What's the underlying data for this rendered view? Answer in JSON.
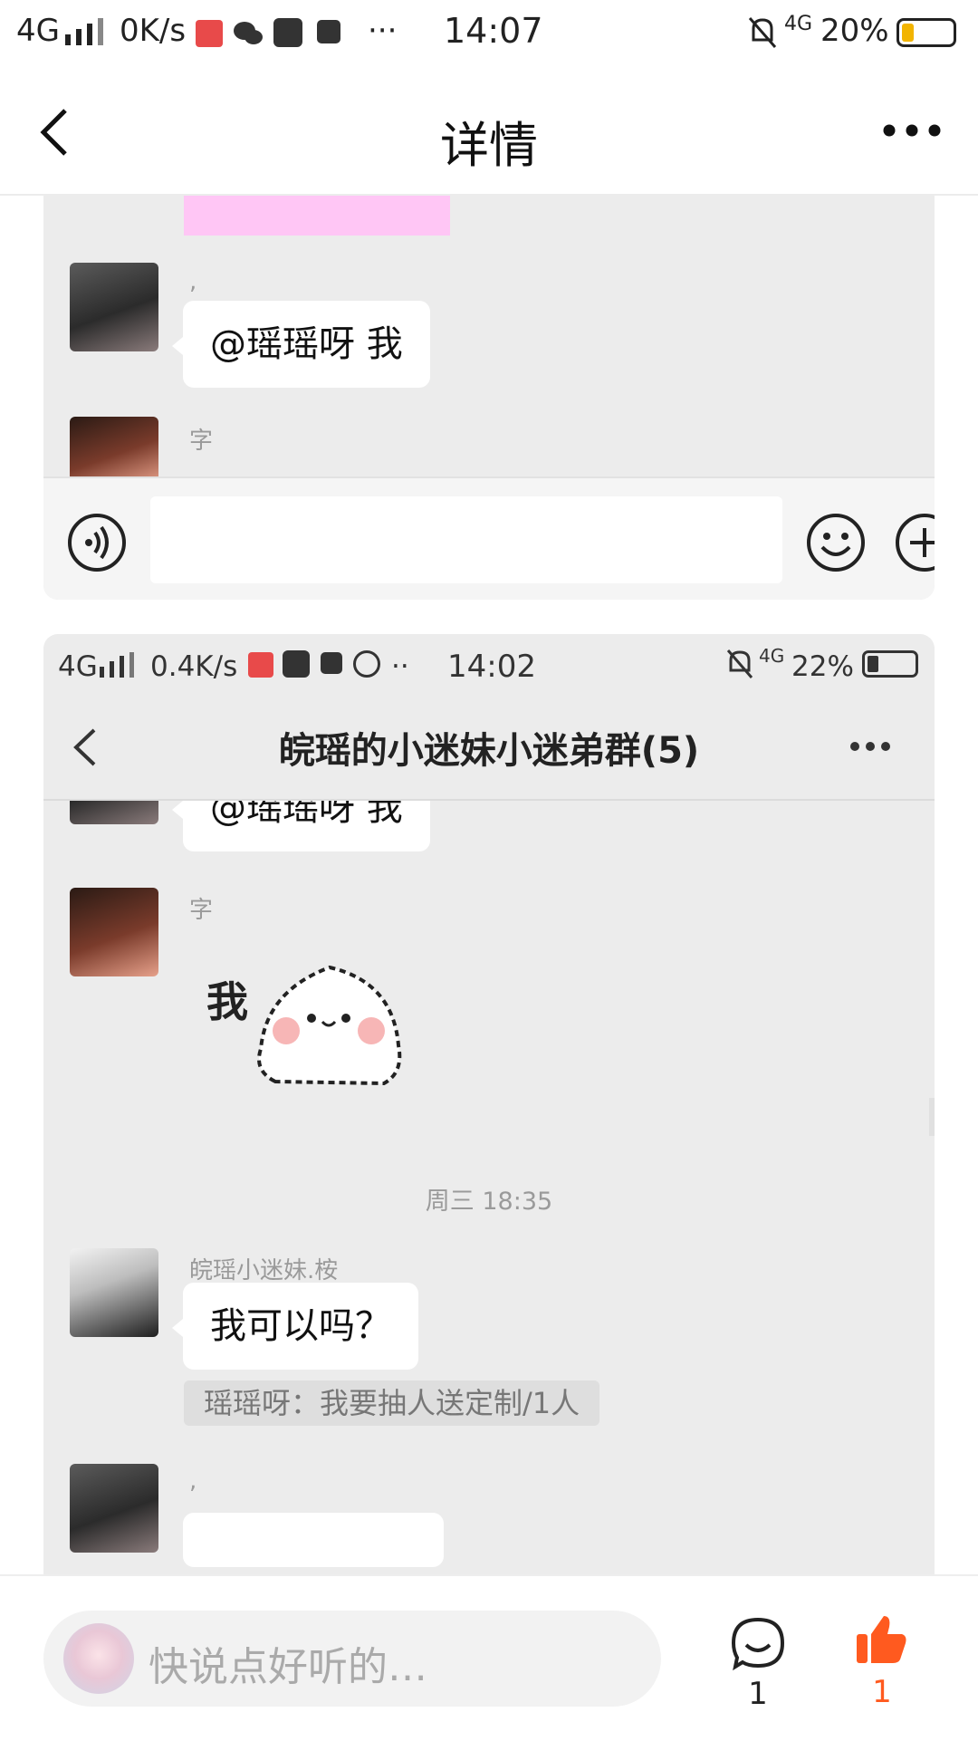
{
  "status_bar": {
    "signal": "4G",
    "speed": "0K/s",
    "dots": "···",
    "time": "14:07",
    "network": "4G",
    "battery": "20%"
  },
  "nav": {
    "title": "详情"
  },
  "top_shot": {
    "messages": [
      {
        "sender": ",",
        "text": "@瑶瑶呀  我"
      },
      {
        "sender": "字"
      }
    ]
  },
  "bottom_shot": {
    "status_bar": {
      "signal": "4G",
      "speed": "0.4K/s",
      "dots": "··",
      "time": "14:02",
      "network": "4G",
      "battery": "22%"
    },
    "title": "皖瑶的小迷妹小迷弟群(5)",
    "partial_bubble": "@瑶瑶呀  我",
    "sender_1": "字",
    "sticker_text": "我",
    "timestamp": "周三 18:35",
    "sender_2": "皖瑶小迷妹.桉",
    "message_2": "我可以吗？",
    "quote": "瑶瑶呀：我要抽人送定制/1人",
    "sender_3": ","
  },
  "footer": {
    "comment_placeholder": "快说点好听的…",
    "comment_count": "1",
    "like_count": "1"
  },
  "colors": {
    "accent": "#ff5a1f",
    "highlight": "#ffc6f5"
  }
}
